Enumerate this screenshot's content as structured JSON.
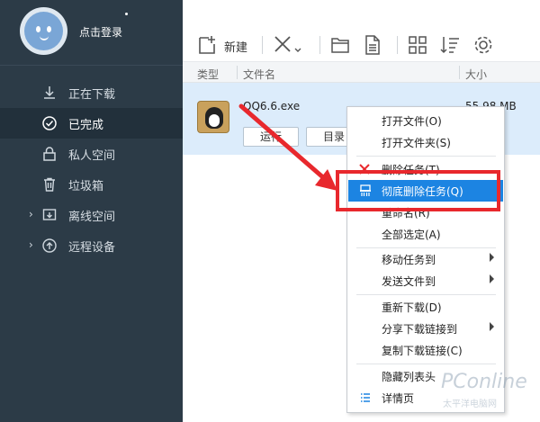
{
  "sidebar": {
    "login_text": "点击登录",
    "items": [
      {
        "label": "正在下载",
        "icon": "download-icon"
      },
      {
        "label": "已完成",
        "icon": "check-circle-icon"
      },
      {
        "label": "私人空间",
        "icon": "lock-icon"
      },
      {
        "label": "垃圾箱",
        "icon": "trash-icon"
      },
      {
        "label": "离线空间",
        "icon": "cloud-download-icon"
      },
      {
        "label": "远程设备",
        "icon": "remote-device-icon"
      }
    ]
  },
  "toolbar": {
    "new_label": "新建"
  },
  "columns": {
    "type": "类型",
    "name": "文件名",
    "size": "大小"
  },
  "file": {
    "name": "QQ6.6.exe",
    "size": "55.98 MB",
    "run_label": "运行",
    "dir_label": "目录"
  },
  "context_menu": {
    "items": [
      {
        "label": "打开文件(O)"
      },
      {
        "label": "打开文件夹(S)"
      },
      {
        "label": "删除任务(T)"
      },
      {
        "label": "彻底删除任务(Q)"
      },
      {
        "label": "重命名(R)"
      },
      {
        "label": "全部选定(A)"
      },
      {
        "label": "移动任务到"
      },
      {
        "label": "发送文件到"
      },
      {
        "label": "重新下载(D)"
      },
      {
        "label": "分享下载链接到"
      },
      {
        "label": "复制下载链接(C)"
      },
      {
        "label": "隐藏列表头"
      },
      {
        "label": "详情页"
      }
    ]
  },
  "watermark": {
    "brand": "PConline",
    "sub": "太平洋电脑网"
  },
  "colors": {
    "sidebar_bg": "#2c3b47",
    "highlight": "#1c84e2",
    "annotation_red": "#e8282d",
    "row_selected": "#dcecfb"
  }
}
